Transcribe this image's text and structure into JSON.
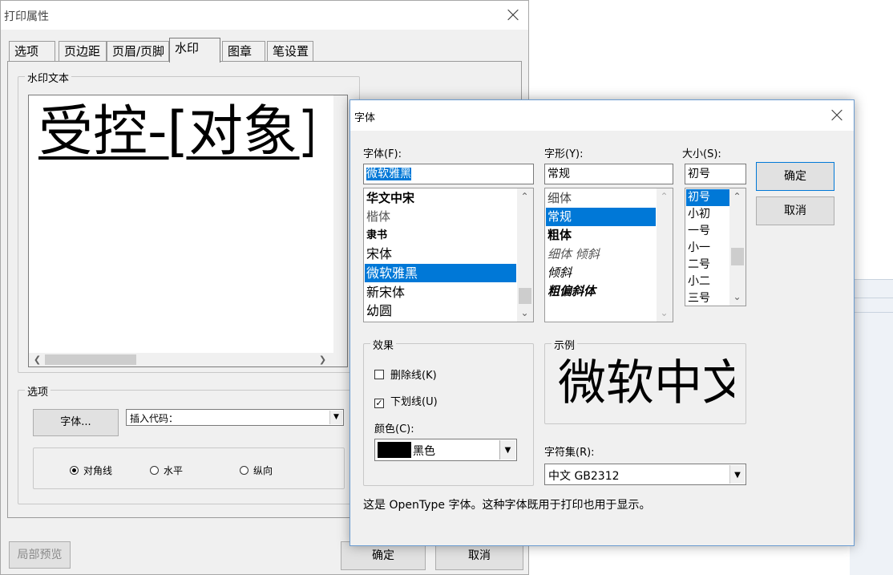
{
  "print_props": {
    "title": "打印属性",
    "tabs": [
      "选项",
      "页边距",
      "页眉/页脚",
      "水印",
      "图章",
      "笔设置"
    ],
    "active_tab": 3,
    "watermark_group": "水印文本",
    "watermark_text": "受控-[对象]",
    "options_group": "选项",
    "font_button": "字体...",
    "insert_code": "插入代码：",
    "radios": [
      {
        "label": "对角线",
        "checked": true
      },
      {
        "label": "水平",
        "checked": false
      },
      {
        "label": "纵向",
        "checked": false
      }
    ],
    "preview_button": "局部预览",
    "ok_button": "确定",
    "cancel_button": "取消"
  },
  "font_dialog": {
    "title": "字体",
    "font_label": "字体(F):",
    "font_value": "微软雅黑",
    "fonts": [
      "华文中宋",
      "楷体",
      "隶书",
      "宋体",
      "微软雅黑",
      "新宋体",
      "幼圆"
    ],
    "font_selected": 4,
    "style_label": "字形(Y):",
    "style_value": "常规",
    "styles": [
      "细体",
      "常规",
      "粗体",
      "细体 倾斜",
      "倾斜",
      "粗偏斜体"
    ],
    "style_selected": 1,
    "size_label": "大小(S):",
    "size_value": "初号",
    "sizes": [
      "初号",
      "小初",
      "一号",
      "小一",
      "二号",
      "小二",
      "三号"
    ],
    "size_selected": 0,
    "ok_button": "确定",
    "cancel_button": "取消",
    "effects_group": "效果",
    "strikeout_label": "删除线(K)",
    "strikeout_checked": false,
    "underline_label": "下划线(U)",
    "underline_checked": true,
    "color_label": "颜色(C):",
    "color_value": "黑色",
    "color_swatch": "#000000",
    "sample_group": "示例",
    "sample_text": "微软中文",
    "charset_label": "字符集(R):",
    "charset_value": "中文 GB2312",
    "info_text": "这是 OpenType 字体。这种字体既用于打印也用于显示。"
  },
  "colors": {
    "selection": "#0078d7",
    "default_button_border": "#0078d7"
  }
}
